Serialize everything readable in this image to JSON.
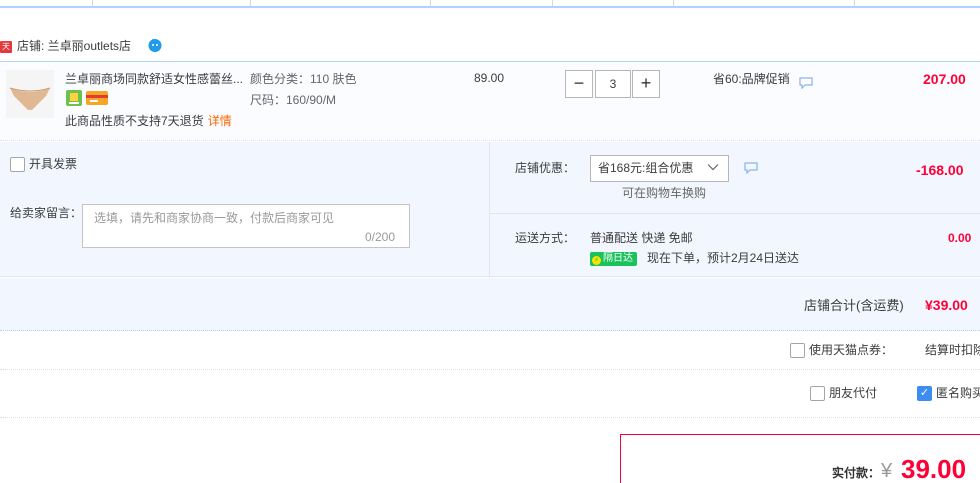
{
  "shop": {
    "badge": "天猫",
    "name": "店铺: 兰卓丽outlets店"
  },
  "item": {
    "title": "兰卓丽商场同款舒适女性感蕾丝...",
    "color_label": "颜色分类：110 肤色",
    "size_label": "尺码：160/90/M",
    "no_return_text": "此商品性质不支持7天退货",
    "detail_link": "详情",
    "unit_price": "89.00",
    "quantity": "3",
    "qty_minus": "−",
    "qty_plus": "+",
    "promo": "省60:品牌促销",
    "total": "207.00"
  },
  "options": {
    "invoice_label": "开具发票",
    "message_label": "给卖家留言：",
    "message_placeholder": "选填，请先和商家协商一致，付款后商家可见",
    "message_count": "0/200",
    "shop_promo_label": "店铺优惠：",
    "shop_promo_selected": "省168元:组合优惠",
    "shop_promo_sub": "可在购物车换购",
    "shop_promo_amount": "-168.00",
    "shipping_label": "运送方式：",
    "shipping_method": "普通配送 快递 免邮",
    "nextday_badge": "隔日达",
    "delivery_text": "现在下单，预计2月24日送达",
    "shipping_cost": "0.00"
  },
  "shop_total": {
    "label": "店铺合计(含运费)",
    "value": "¥39.00"
  },
  "bottom": {
    "points_label": "使用天猫点券：",
    "settle_label": "结算时扣除",
    "friend_pay_label": "朋友代付",
    "anonymous_label": "匿名购买",
    "anonymous_checked": true
  },
  "pay": {
    "label": "实付款：",
    "currency": "¥",
    "amount": "39.00"
  },
  "colors": {
    "accent_red": "#ff0036",
    "border_blue": "#b2d1ff",
    "panel_bg": "#f2f7ff",
    "nextday_green": "#19c25a",
    "check_blue": "#3d8cf0"
  },
  "icons": [
    "wangwang-chat-icon",
    "chat-bubble-icon",
    "chevron-down-icon",
    "checkmark-icon",
    "member-badge-icon",
    "card-badge-icon"
  ]
}
